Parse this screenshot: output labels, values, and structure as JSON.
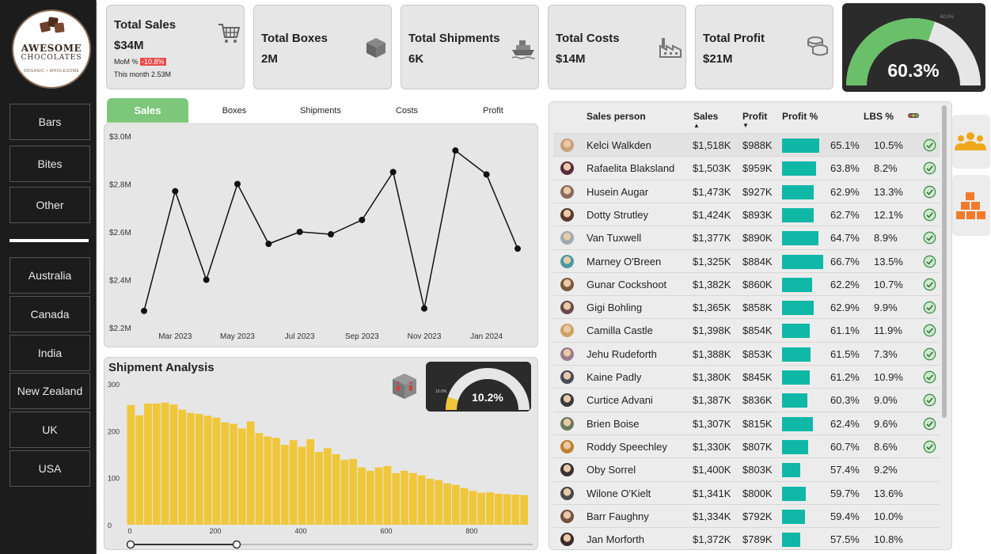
{
  "sidebar": {
    "logo": {
      "line1": "AWESOME",
      "line2": "CHOCOLATES",
      "line3": "ORGANIC • WHOLESOME"
    },
    "categories": [
      "Bars",
      "Bites",
      "Other"
    ],
    "countries": [
      "Australia",
      "Canada",
      "India",
      "New Zealand",
      "UK",
      "USA"
    ]
  },
  "kpis": {
    "sales": {
      "title": "Total Sales",
      "value": "$34M",
      "mom_label": "MoM %",
      "mom_value": "-10.8%",
      "month_label": "This month 2.53M",
      "icon": "shopping-cart-icon"
    },
    "boxes": {
      "title": "Total Boxes",
      "value": "2M",
      "icon": "box-icon"
    },
    "shipments": {
      "title": "Total Shipments",
      "value": "6K",
      "icon": "ship-icon"
    },
    "costs": {
      "title": "Total Costs",
      "value": "$14M",
      "icon": "factory-icon"
    },
    "profit": {
      "title": "Total Profit",
      "value": "$21M",
      "icon": "coins-icon"
    }
  },
  "profit_gauge": {
    "value": 60.3,
    "label": "60.3%",
    "target_label": "60.0%",
    "fill_color": "#6abf69",
    "track_color": "#e6e6e6"
  },
  "tabs": [
    "Sales",
    "Boxes",
    "Shipments",
    "Costs",
    "Profit"
  ],
  "active_tab": "Sales",
  "colors": {
    "accent_green": "#7dc77b",
    "teal_bar": "#0fb8a6",
    "yellow_bar": "#f0c63b",
    "negative": "#e84a4a"
  },
  "chart_data": [
    {
      "type": "line",
      "title": "",
      "xlabel": "",
      "ylabel": "",
      "x": [
        "Feb 2023",
        "Mar 2023",
        "Apr 2023",
        "May 2023",
        "Jun 2023",
        "Jul 2023",
        "Aug 2023",
        "Sep 2023",
        "Oct 2023",
        "Nov 2023",
        "Dec 2023",
        "Jan 2024",
        "Feb 2024"
      ],
      "values": [
        2.27,
        2.77,
        2.4,
        2.8,
        2.55,
        2.6,
        2.59,
        2.65,
        2.85,
        2.28,
        2.94,
        2.84,
        2.53
      ],
      "x_tick_labels": [
        "Mar 2023",
        "May 2023",
        "Jul 2023",
        "Sep 2023",
        "Nov 2023",
        "Jan 2024"
      ],
      "y_tick_labels": [
        "$2.2M",
        "$2.4M",
        "$2.6M",
        "$2.8M",
        "$3.0M"
      ],
      "ylim": [
        2.2,
        3.0
      ],
      "grid": false
    },
    {
      "type": "bar",
      "title": "Shipment Analysis",
      "xlabel": "",
      "ylabel": "",
      "x_tick_labels": [
        "0",
        "200",
        "400",
        "600",
        "800"
      ],
      "y_tick_labels": [
        "0",
        "100",
        "200",
        "300"
      ],
      "ylim": [
        0,
        300
      ],
      "bin_width": 20,
      "values": [
        255,
        233,
        258,
        258,
        260,
        256,
        245,
        238,
        236,
        232,
        228,
        218,
        215,
        205,
        220,
        195,
        188,
        185,
        170,
        180,
        166,
        182,
        155,
        163,
        150,
        138,
        140,
        122,
        115,
        122,
        125,
        110,
        115,
        110,
        105,
        98,
        95,
        88,
        85,
        78,
        72,
        68,
        69,
        66,
        65,
        64,
        63,
        61,
        58,
        57,
        55,
        54,
        53,
        52,
        50,
        49,
        48,
        47,
        46,
        45,
        44,
        43,
        42,
        41,
        40,
        40,
        38,
        37,
        36,
        35,
        34,
        33,
        32,
        31,
        30,
        30,
        29,
        28,
        27,
        26,
        25,
        24,
        23,
        22,
        21,
        20,
        19,
        18,
        17,
        16,
        15,
        14,
        13,
        13,
        12,
        11,
        10,
        9,
        8,
        8,
        7,
        6,
        5,
        5,
        4,
        4,
        3,
        3,
        2,
        2,
        2,
        1
      ],
      "grid": false
    }
  ],
  "shipment_gauge": {
    "value": 10.2,
    "label": "10.2%",
    "target_label": "10.0%",
    "fill_color": "#f0c63b",
    "track_color": "#e6e6e6"
  },
  "table": {
    "columns": [
      "Sales person",
      "Sales",
      "Profit",
      "Profit %",
      "LBS %"
    ],
    "rows": [
      {
        "name": "Kelci Walkden",
        "sales": "$1,518K",
        "profit": "$988K",
        "profit_pct": "65.1%",
        "profit_frac": 0.651,
        "lbs": "10.5%",
        "check": true,
        "avatar": "#c9a07a"
      },
      {
        "name": "Rafaelita Blaksland",
        "sales": "$1,503K",
        "profit": "$959K",
        "profit_pct": "63.8%",
        "profit_frac": 0.638,
        "lbs": "8.2%",
        "check": true,
        "avatar": "#5a2b3b"
      },
      {
        "name": "Husein Augar",
        "sales": "$1,473K",
        "profit": "$927K",
        "profit_pct": "62.9%",
        "profit_frac": 0.629,
        "lbs": "13.3%",
        "check": true,
        "avatar": "#8a6a5a"
      },
      {
        "name": "Dotty Strutley",
        "sales": "$1,424K",
        "profit": "$893K",
        "profit_pct": "62.7%",
        "profit_frac": 0.627,
        "lbs": "12.1%",
        "check": true,
        "avatar": "#5b3a2a"
      },
      {
        "name": "Van Tuxwell",
        "sales": "$1,377K",
        "profit": "$890K",
        "profit_pct": "64.7%",
        "profit_frac": 0.647,
        "lbs": "8.9%",
        "check": true,
        "avatar": "#a0a8b0"
      },
      {
        "name": "Marney O'Breen",
        "sales": "$1,325K",
        "profit": "$884K",
        "profit_pct": "66.7%",
        "profit_frac": 0.667,
        "lbs": "13.5%",
        "check": true,
        "avatar": "#4a9aa0"
      },
      {
        "name": "Gunar Cockshoot",
        "sales": "$1,382K",
        "profit": "$860K",
        "profit_pct": "62.2%",
        "profit_frac": 0.622,
        "lbs": "10.7%",
        "check": true,
        "avatar": "#7a5a3a"
      },
      {
        "name": "Gigi Bohling",
        "sales": "$1,365K",
        "profit": "$858K",
        "profit_pct": "62.9%",
        "profit_frac": 0.629,
        "lbs": "9.9%",
        "check": true,
        "avatar": "#6a4a4a"
      },
      {
        "name": "Camilla Castle",
        "sales": "$1,398K",
        "profit": "$854K",
        "profit_pct": "61.1%",
        "profit_frac": 0.611,
        "lbs": "11.9%",
        "check": true,
        "avatar": "#d0a060"
      },
      {
        "name": "Jehu Rudeforth",
        "sales": "$1,388K",
        "profit": "$853K",
        "profit_pct": "61.5%",
        "profit_frac": 0.615,
        "lbs": "7.3%",
        "check": true,
        "avatar": "#9a7a8a"
      },
      {
        "name": "Kaine Padly",
        "sales": "$1,380K",
        "profit": "$845K",
        "profit_pct": "61.2%",
        "profit_frac": 0.612,
        "lbs": "10.9%",
        "check": true,
        "avatar": "#4a4a5a"
      },
      {
        "name": "Curtice Advani",
        "sales": "$1,387K",
        "profit": "$836K",
        "profit_pct": "60.3%",
        "profit_frac": 0.603,
        "lbs": "9.0%",
        "check": true,
        "avatar": "#3a3a3a"
      },
      {
        "name": "Brien Boise",
        "sales": "$1,307K",
        "profit": "$815K",
        "profit_pct": "62.4%",
        "profit_frac": 0.624,
        "lbs": "9.6%",
        "check": true,
        "avatar": "#6a7a5a"
      },
      {
        "name": "Roddy Speechley",
        "sales": "$1,330K",
        "profit": "$807K",
        "profit_pct": "60.7%",
        "profit_frac": 0.607,
        "lbs": "8.6%",
        "check": true,
        "avatar": "#c08030"
      },
      {
        "name": "Oby Sorrel",
        "sales": "$1,400K",
        "profit": "$803K",
        "profit_pct": "57.4%",
        "profit_frac": 0.574,
        "lbs": "9.2%",
        "check": false,
        "avatar": "#3a3030"
      },
      {
        "name": "Wilone O'Kielt",
        "sales": "$1,341K",
        "profit": "$800K",
        "profit_pct": "59.7%",
        "profit_frac": 0.597,
        "lbs": "13.6%",
        "check": false,
        "avatar": "#4a4a4a"
      },
      {
        "name": "Barr Faughny",
        "sales": "$1,334K",
        "profit": "$792K",
        "profit_pct": "59.4%",
        "profit_frac": 0.594,
        "lbs": "10.0%",
        "check": false,
        "avatar": "#7a5040"
      },
      {
        "name": "Jan Morforth",
        "sales": "$1,372K",
        "profit": "$789K",
        "profit_pct": "57.5%",
        "profit_frac": 0.575,
        "lbs": "10.8%",
        "check": false,
        "avatar": "#3a2a2a"
      }
    ]
  },
  "side_icons": [
    "team-icon",
    "boxes-stack-icon"
  ]
}
